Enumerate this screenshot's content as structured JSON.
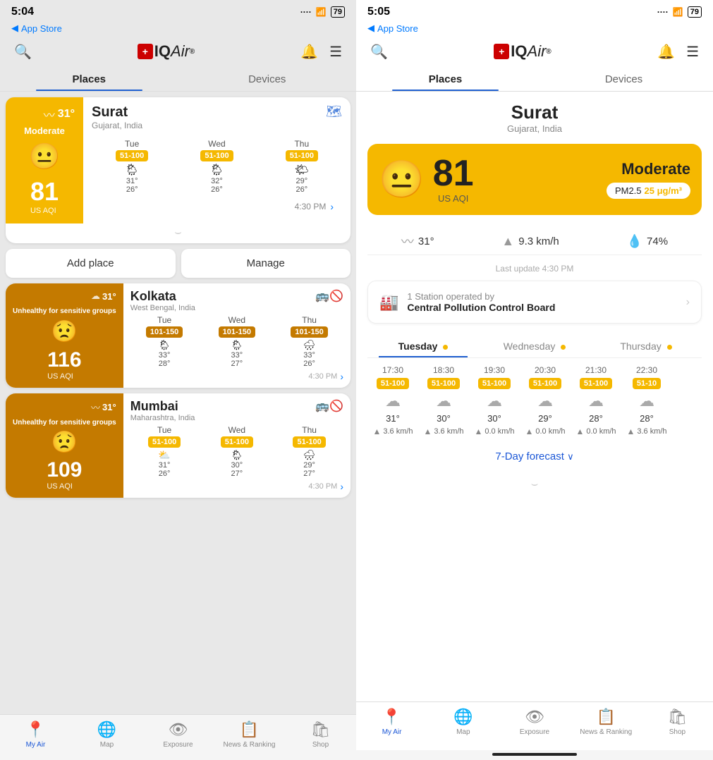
{
  "left": {
    "time": "5:04",
    "app_store": "App Store",
    "tabs": [
      "Places",
      "Devices"
    ],
    "active_tab": "Places",
    "surat": {
      "temp": "31°",
      "status": "Moderate",
      "aqi": "81",
      "aqi_unit": "US AQI",
      "city": "Surat",
      "location": "Gujarat, India",
      "forecast": [
        {
          "day": "Tue",
          "aqi_range": "51-100",
          "high": "31°",
          "low": "26°",
          "icon": "🌦"
        },
        {
          "day": "Wed",
          "aqi_range": "51-100",
          "high": "32°",
          "low": "26°",
          "icon": "🌦"
        },
        {
          "day": "Thu",
          "aqi_range": "51-100",
          "high": "29°",
          "low": "26°",
          "icon": "🌤"
        }
      ],
      "update_time": "4:30 PM"
    },
    "add_place": "Add place",
    "manage": "Manage",
    "cities": [
      {
        "name": "Kolkata",
        "location": "West Bengal, India",
        "temp": "31°",
        "status": "Unhealthy for sensitive groups",
        "aqi": "116",
        "aqi_unit": "US AQI",
        "forecast": [
          {
            "day": "Tue",
            "aqi_range": "101-150",
            "high": "33°",
            "low": "28°",
            "icon": "🌦"
          },
          {
            "day": "Wed",
            "aqi_range": "101-150",
            "high": "33°",
            "low": "27°",
            "icon": "🌦"
          },
          {
            "day": "Thu",
            "aqi_range": "101-150",
            "high": "33°",
            "low": "26°",
            "icon": "🌧"
          }
        ],
        "update_time": "4:30 PM"
      },
      {
        "name": "Mumbai",
        "location": "Maharashtra, India",
        "temp": "31°",
        "status": "Unhealthy for sensitive groups",
        "aqi": "109",
        "aqi_unit": "US AQI",
        "forecast": [
          {
            "day": "Tue",
            "aqi_range": "51-100",
            "high": "31°",
            "low": "26°",
            "icon": "⛅"
          },
          {
            "day": "Wed",
            "aqi_range": "51-100",
            "high": "30°",
            "low": "27°",
            "icon": "🌦"
          },
          {
            "day": "Thu",
            "aqi_range": "51-100",
            "high": "29°",
            "low": "27°",
            "icon": "🌧"
          }
        ],
        "update_time": "4:30 PM"
      }
    ],
    "bottom_nav": [
      {
        "label": "My Air",
        "active": true,
        "icon": "📍"
      },
      {
        "label": "Map",
        "active": false,
        "icon": "🌐"
      },
      {
        "label": "Exposure",
        "active": false,
        "icon": "👁"
      },
      {
        "label": "News & Ranking",
        "active": false,
        "icon": "📋"
      },
      {
        "label": "Shop",
        "active": false,
        "icon": "🛍"
      }
    ]
  },
  "right": {
    "time": "5:05",
    "app_store": "App Store",
    "tabs": [
      "Places",
      "Devices"
    ],
    "active_tab": "Places",
    "city": "Surat",
    "location": "Gujarat, India",
    "aqi": "81",
    "aqi_unit": "US AQI",
    "aqi_status": "Moderate",
    "pm25_label": "PM2.5",
    "pm25_value": "25 μg/m³",
    "temp": "31°",
    "wind": "9.3 km/h",
    "humidity": "74%",
    "last_update": "Last update 4:30 PM",
    "station_count": "1 Station operated by",
    "station_name": "Central Pollution Control Board",
    "forecast_tabs": [
      "Tuesday",
      "Wednesday",
      "Thursday"
    ],
    "hourly": [
      {
        "time": "17:30",
        "aqi": "51-100",
        "icon": "☁",
        "temp": "31°",
        "wind": "3.6 km/h"
      },
      {
        "time": "18:30",
        "aqi": "51-100",
        "icon": "☁",
        "temp": "30°",
        "wind": "3.6 km/h"
      },
      {
        "time": "19:30",
        "aqi": "51-100",
        "icon": "☁",
        "temp": "30°",
        "wind": "0.0 km/h"
      },
      {
        "time": "20:30",
        "aqi": "51-100",
        "icon": "☁",
        "temp": "29°",
        "wind": "0.0 km/h"
      },
      {
        "time": "21:30",
        "aqi": "51-100",
        "icon": "☁",
        "temp": "28°",
        "wind": "0.0 km/h"
      },
      {
        "time": "22:30",
        "aqi": "51-10",
        "icon": "☁",
        "temp": "28°",
        "wind": "3.6 km/h"
      }
    ],
    "seven_day_label": "7-Day forecast",
    "bottom_nav": [
      {
        "label": "My Air",
        "active": true,
        "icon": "📍"
      },
      {
        "label": "Map",
        "active": false,
        "icon": "🌐"
      },
      {
        "label": "Exposure",
        "active": false,
        "icon": "👁"
      },
      {
        "label": "News & Ranking",
        "active": false,
        "icon": "📋"
      },
      {
        "label": "Shop",
        "active": false,
        "icon": "🛍"
      }
    ]
  }
}
